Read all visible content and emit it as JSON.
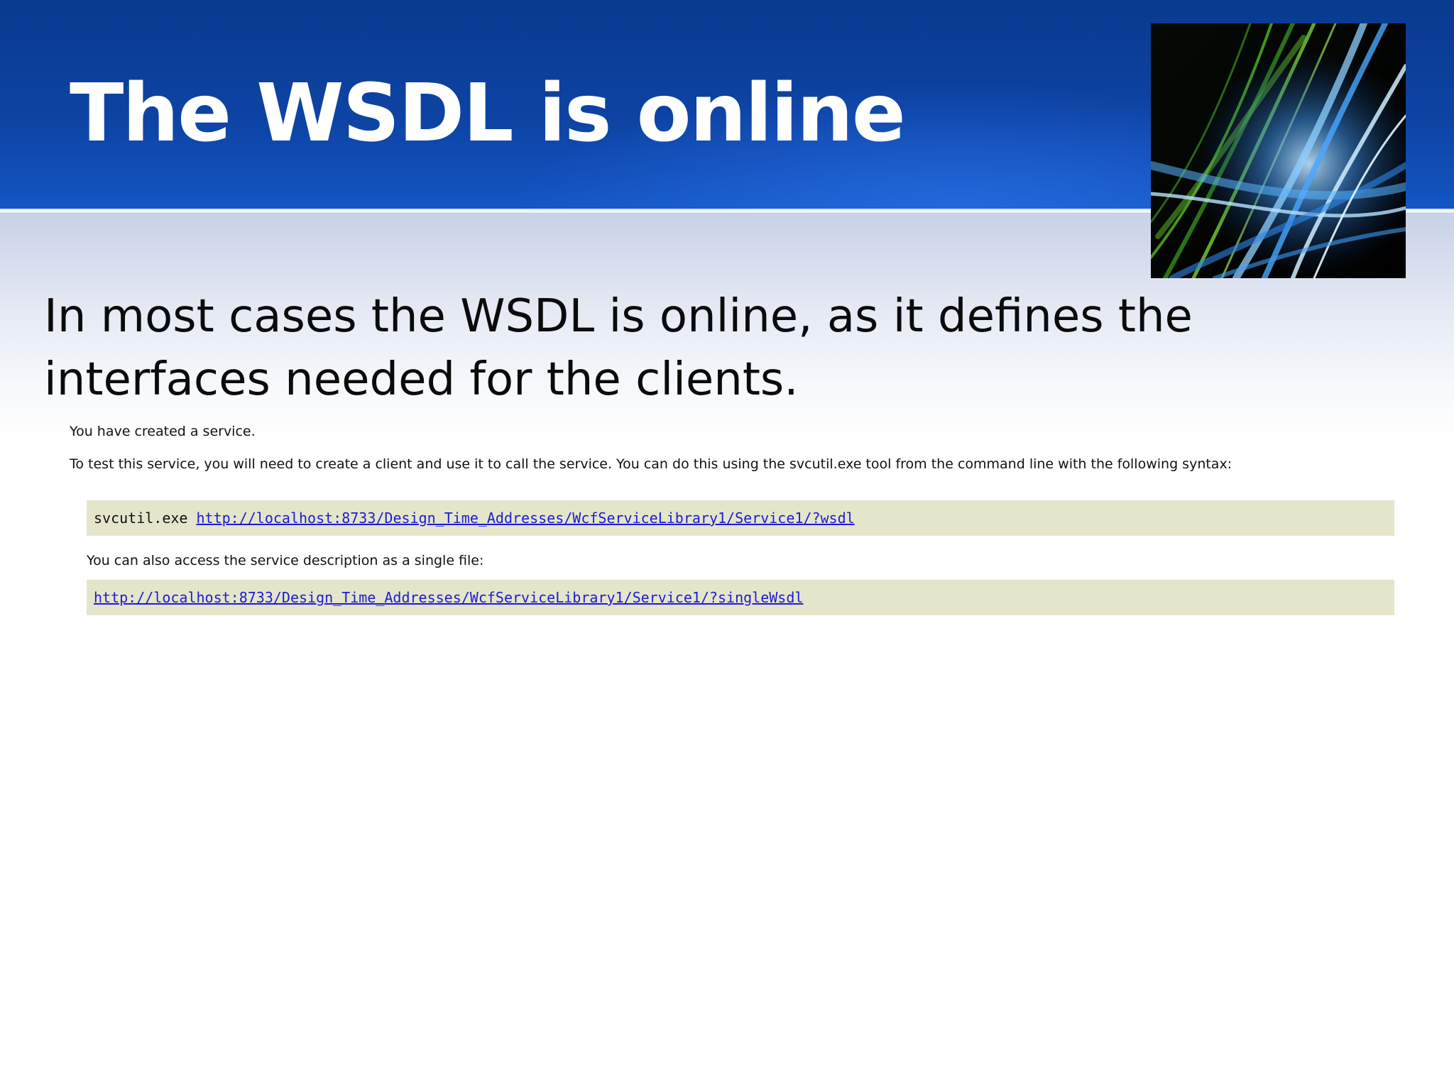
{
  "slide": {
    "title": "The WSDL is online",
    "body": "In most cases the WSDL is online, as it defines the interfaces needed for the clients."
  },
  "service_page": {
    "created_message": "You have created a service.",
    "instructions": "To test this service, you will need to create a client and use it to call the service. You can do this using the svcutil.exe tool from the command line with the following syntax:",
    "command": "svcutil.exe",
    "wsdl_link": "http://localhost:8733/Design_Time_Addresses/WcfServiceLibrary1/Service1/?wsdl",
    "single_file_message": "You can also access the service description as a single file:",
    "single_wsdl_link": "http://localhost:8733/Design_Time_Addresses/WcfServiceLibrary1/Service1/?singleWsdl"
  },
  "colors": {
    "title_band": "#0d43a3",
    "link": "#1b1bd6",
    "code_background": "#e5e5cc"
  }
}
